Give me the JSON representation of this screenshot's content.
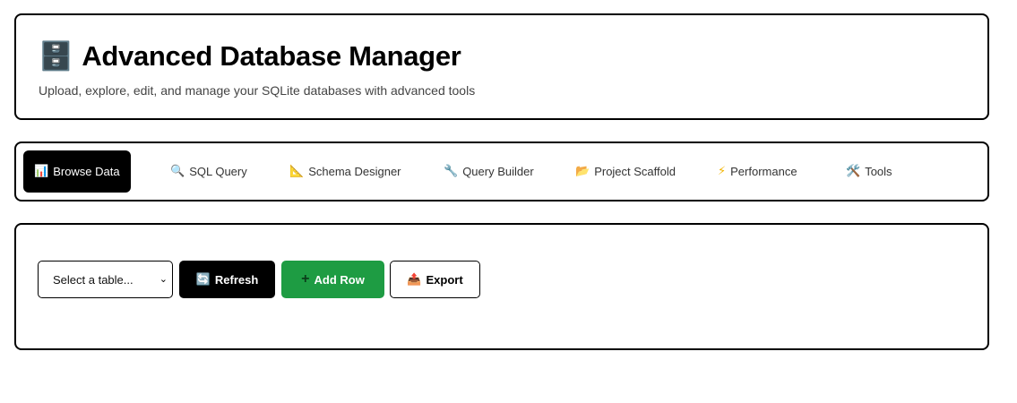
{
  "header": {
    "icon": "file-cabinet-icon",
    "title": "Advanced Database Manager",
    "subtitle": "Upload, explore, edit, and manage your SQLite databases with advanced tools"
  },
  "tabs": [
    {
      "label": "Browse Data",
      "icon": "bar-chart-icon",
      "active": true
    },
    {
      "label": "SQL Query",
      "icon": "magnifier-icon"
    },
    {
      "label": "Schema Designer",
      "icon": "ruler-icon"
    },
    {
      "label": "Query Builder",
      "icon": "wrench-icon"
    },
    {
      "label": "Project Scaffold",
      "icon": "folder-icon"
    },
    {
      "label": "Performance",
      "icon": "lightning-icon"
    },
    {
      "label": "Tools",
      "icon": "hammer-wrench-icon"
    }
  ],
  "controls": {
    "table_select": "Select a table...",
    "refresh_label": "Refresh",
    "add_row_label": "Add Row",
    "export_label": "Export"
  },
  "colors": {
    "accent": "#000000",
    "add_button": "#1e9c43"
  }
}
